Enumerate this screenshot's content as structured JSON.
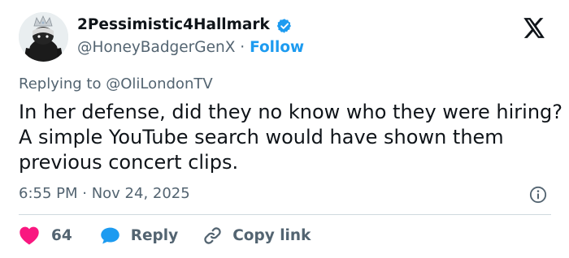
{
  "author": {
    "display_name": "2Pessimistic4Hallmark",
    "handle": "@HoneyBadgerGenX",
    "separator": " · ",
    "follow_label": "Follow"
  },
  "reply_context": {
    "prefix": "Replying to ",
    "mention": "@OliLondonTV"
  },
  "tweet": {
    "text": "In her defense, did they no know who they were hiring? A simple YouTube search would have shown them previous concert clips.",
    "time": "6:55 PM",
    "separator": " · ",
    "date": "Nov 24, 2025"
  },
  "actions": {
    "like_count": "64",
    "reply_label": "Reply",
    "copy_link_label": "Copy link"
  },
  "icons": {
    "verified": "verified-badge-icon",
    "platform": "x-logo-icon",
    "info": "info-icon",
    "like": "heart-icon",
    "reply": "speech-bubble-icon",
    "copy_link": "link-icon"
  },
  "colors": {
    "text": "#0f1419",
    "secondary": "#536471",
    "accent": "#1d9bf0",
    "like": "#f91880",
    "divider": "#cfd9de"
  }
}
